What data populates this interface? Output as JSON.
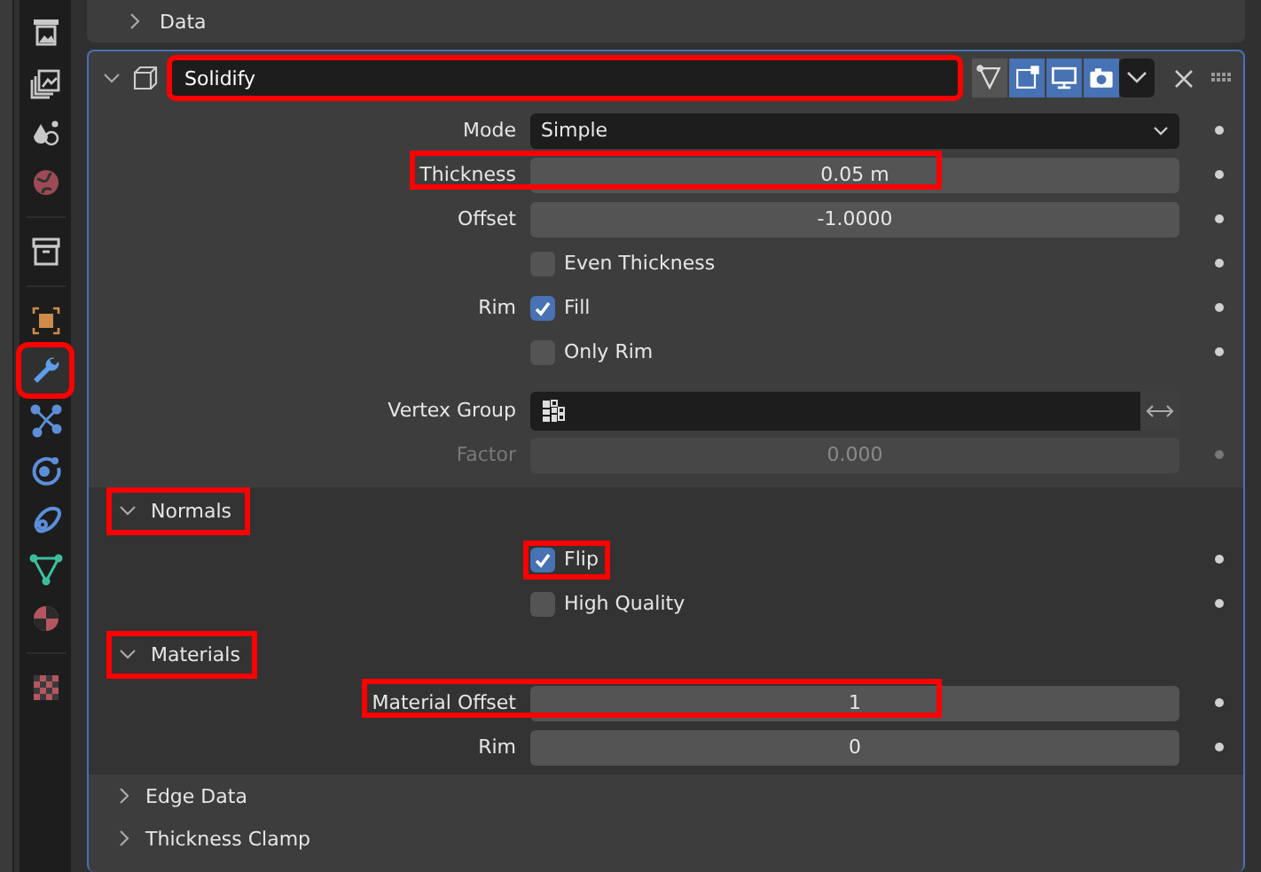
{
  "sidebar": {
    "tabs": [
      {
        "kind": "output",
        "selected": false,
        "highlighted": false
      },
      {
        "kind": "view_layer",
        "selected": false,
        "highlighted": false
      },
      {
        "kind": "scene",
        "selected": false,
        "highlighted": false
      },
      {
        "kind": "world",
        "selected": false,
        "highlighted": false
      },
      {
        "kind": "collection",
        "selected": false,
        "highlighted": false
      },
      {
        "kind": "object",
        "selected": false,
        "highlighted": false
      },
      {
        "kind": "modifiers",
        "selected": true,
        "highlighted": true
      },
      {
        "kind": "particles",
        "selected": false,
        "highlighted": false
      },
      {
        "kind": "physics",
        "selected": false,
        "highlighted": false
      },
      {
        "kind": "constraints",
        "selected": false,
        "highlighted": false
      },
      {
        "kind": "data",
        "selected": false,
        "highlighted": false
      },
      {
        "kind": "material",
        "selected": false,
        "highlighted": false
      },
      {
        "kind": "texture",
        "selected": false,
        "highlighted": false
      }
    ]
  },
  "data_panel": {
    "label": "Data",
    "expanded": false
  },
  "modifier": {
    "name": "Solidify",
    "expanded": true,
    "highlighted": true,
    "toggles": [
      {
        "kind": "edit_cage",
        "on": false
      },
      {
        "kind": "edit_mode",
        "on": true
      },
      {
        "kind": "viewport",
        "on": true
      },
      {
        "kind": "render",
        "on": true
      }
    ],
    "rows": [
      {
        "kind": "dropdown",
        "label": "Mode",
        "value": "Simple",
        "highlighted": false,
        "disabled": false
      },
      {
        "kind": "number",
        "label": "Thickness",
        "value": "0.05 m",
        "highlighted": true,
        "disabled": false
      },
      {
        "kind": "number",
        "label": "Offset",
        "value": "-1.0000",
        "highlighted": false,
        "disabled": false
      },
      {
        "kind": "checkbox",
        "text": "Even Thickness",
        "checked": false,
        "highlighted": false
      },
      {
        "kind": "checkbox",
        "label": "Rim",
        "text": "Fill",
        "checked": true,
        "highlighted": false
      },
      {
        "kind": "checkbox",
        "text": "Only Rim",
        "checked": false,
        "highlighted": false
      },
      {
        "kind": "vertex_group",
        "label": "Vertex Group",
        "highlighted": false,
        "disabled": false
      },
      {
        "kind": "number",
        "label": "Factor",
        "value": "0.000",
        "highlighted": false,
        "disabled": true
      }
    ],
    "subpanels": [
      {
        "label": "Normals",
        "expanded": true,
        "highlighted": true,
        "rows": [
          {
            "kind": "checkbox",
            "text": "Flip",
            "checked": true,
            "highlighted": true
          },
          {
            "kind": "checkbox",
            "text": "High Quality",
            "checked": false,
            "highlighted": false
          }
        ]
      },
      {
        "label": "Materials",
        "expanded": true,
        "highlighted": true,
        "rows": [
          {
            "kind": "number",
            "label": "Material Offset",
            "value": "1",
            "highlighted": true,
            "disabled": false
          },
          {
            "kind": "number",
            "label": "Rim",
            "value": "0",
            "highlighted": false,
            "disabled": false
          }
        ]
      },
      {
        "label": "Edge Data",
        "expanded": false,
        "highlighted": false
      },
      {
        "label": "Thickness Clamp",
        "expanded": false,
        "highlighted": false
      }
    ]
  }
}
